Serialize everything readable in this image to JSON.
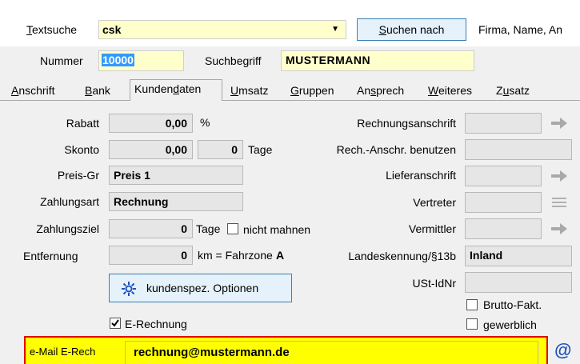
{
  "search": {
    "label_pre": "",
    "label_u": "T",
    "label_post": "extsuche",
    "value": "csk",
    "button_pre": "",
    "button_u": "S",
    "button_post": "uchen nach",
    "hint": "Firma, Name, An"
  },
  "header": {
    "number_label": "Nummer",
    "number_value": "10000",
    "searchterm_label": "Suchbegriff",
    "searchterm_value": "MUSTERMANN"
  },
  "tabs": [
    {
      "pre": "",
      "u": "A",
      "post": "nschrift"
    },
    {
      "pre": "",
      "u": "B",
      "post": "ank"
    },
    {
      "pre": "Kunden",
      "u": "d",
      "post": "aten"
    },
    {
      "pre": "",
      "u": "U",
      "post": "msatz"
    },
    {
      "pre": "",
      "u": "G",
      "post": "ruppen"
    },
    {
      "pre": "An",
      "u": "s",
      "post": "prech"
    },
    {
      "pre": "",
      "u": "W",
      "post": "eiteres"
    },
    {
      "pre": "Z",
      "u": "u",
      "post": "satz"
    }
  ],
  "left": {
    "rabatt_label": "Rabatt",
    "rabatt_value": "0,00",
    "rabatt_unit": "%",
    "skonto_label": "Skonto",
    "skonto_value": "0,00",
    "skonto_unit": "%",
    "skonto_days": "0",
    "skonto_days_unit": "Tage",
    "preisgr_label": "Preis-Gr",
    "preisgr_value": "Preis 1",
    "zahlungsart_label": "Zahlungsart",
    "zahlungsart_value": "Rechnung",
    "zahlungsziel_label": "Zahlungsziel",
    "zahlungsziel_value": "0",
    "zahlungsziel_unit": "Tage",
    "nicht_mahnen_label": "nicht mahnen",
    "entfernung_label": "Entfernung",
    "entfernung_value": "0",
    "entfernung_unit": "km = Fahrzone",
    "fahrzone_value": "A",
    "options_button": "kundenspez. Optionen",
    "erechnung_label": "E-Rechnung"
  },
  "right": {
    "rechnungsanschrift_label": "Rechnungsanschrift",
    "rech_anschr_label": "Rech.-Anschr. benutzen",
    "lieferanschrift_label": "Lieferanschrift",
    "vertreter_label": "Vertreter",
    "vermittler_label": "Vermittler",
    "landeskennung_label": "Landeskennung/§13b",
    "landeskennung_value": "Inland",
    "ustidnr_label": "USt-IdNr",
    "brutto_label": "Brutto-Fakt.",
    "gewerblich_label": "gewerblich"
  },
  "email": {
    "label": "e-Mail E-Rech",
    "value": "rechnung@mustermann.de",
    "icon_glyph": "@"
  },
  "colors": {
    "highlight": "#ffff00",
    "highlight_border": "#e00000",
    "yellow_field": "#ffffcc",
    "icon_blue": "#1f4fbf"
  }
}
